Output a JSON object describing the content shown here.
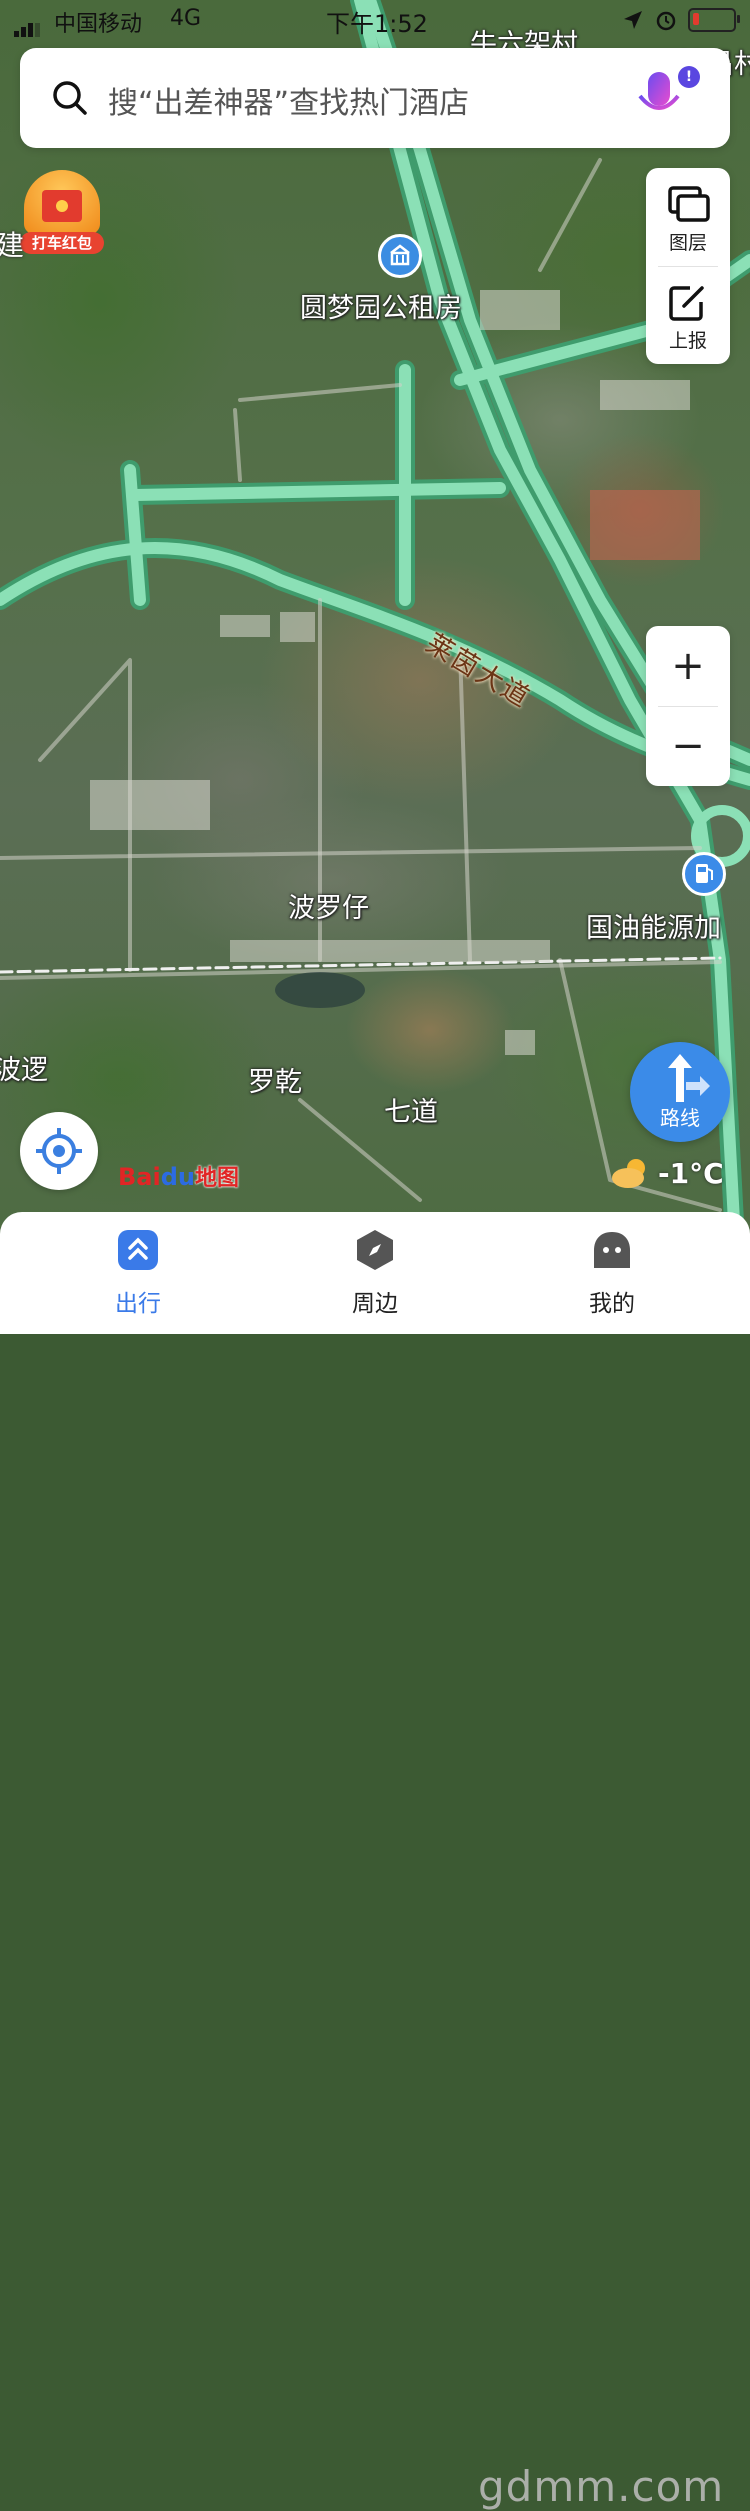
{
  "status_bar": {
    "carrier": "中国移动",
    "network": "4G",
    "time": "下午1:52"
  },
  "search": {
    "placeholder": "搜“出差神器”查找热门酒店",
    "badge": "!"
  },
  "promo": {
    "label": "打车红包"
  },
  "tools": {
    "layers_label": "图层",
    "report_label": "上报"
  },
  "zoom": {
    "in": "+",
    "out": "−"
  },
  "map_labels": {
    "top_village": "牛六架村",
    "top_right": "沙昌村",
    "left_edge": "建",
    "poi_housing": "圆梦园公租房",
    "road": "莱茵大道",
    "area_boluozai": "波罗仔",
    "gas_station": "国油能源加",
    "left_bottom": "波逻",
    "luoqian": "罗乾",
    "qidao": "七道"
  },
  "route": {
    "label": "路线"
  },
  "logo": {
    "bai": "Bai",
    "du": "du",
    "ditu": "地图"
  },
  "weather": {
    "temp": "-1°C",
    "icon": "partly-cloudy-icon"
  },
  "nav": {
    "items": [
      {
        "label": "出行",
        "icon": "travel-icon",
        "active": true
      },
      {
        "label": "周边",
        "icon": "compass-icon",
        "active": false
      },
      {
        "label": "我的",
        "icon": "profile-icon",
        "active": false
      }
    ]
  },
  "watermark": "gdmm.com",
  "colors": {
    "road_green": "#6fcf9c",
    "accent_blue": "#3b8be8",
    "road_label": "#6b3415"
  }
}
